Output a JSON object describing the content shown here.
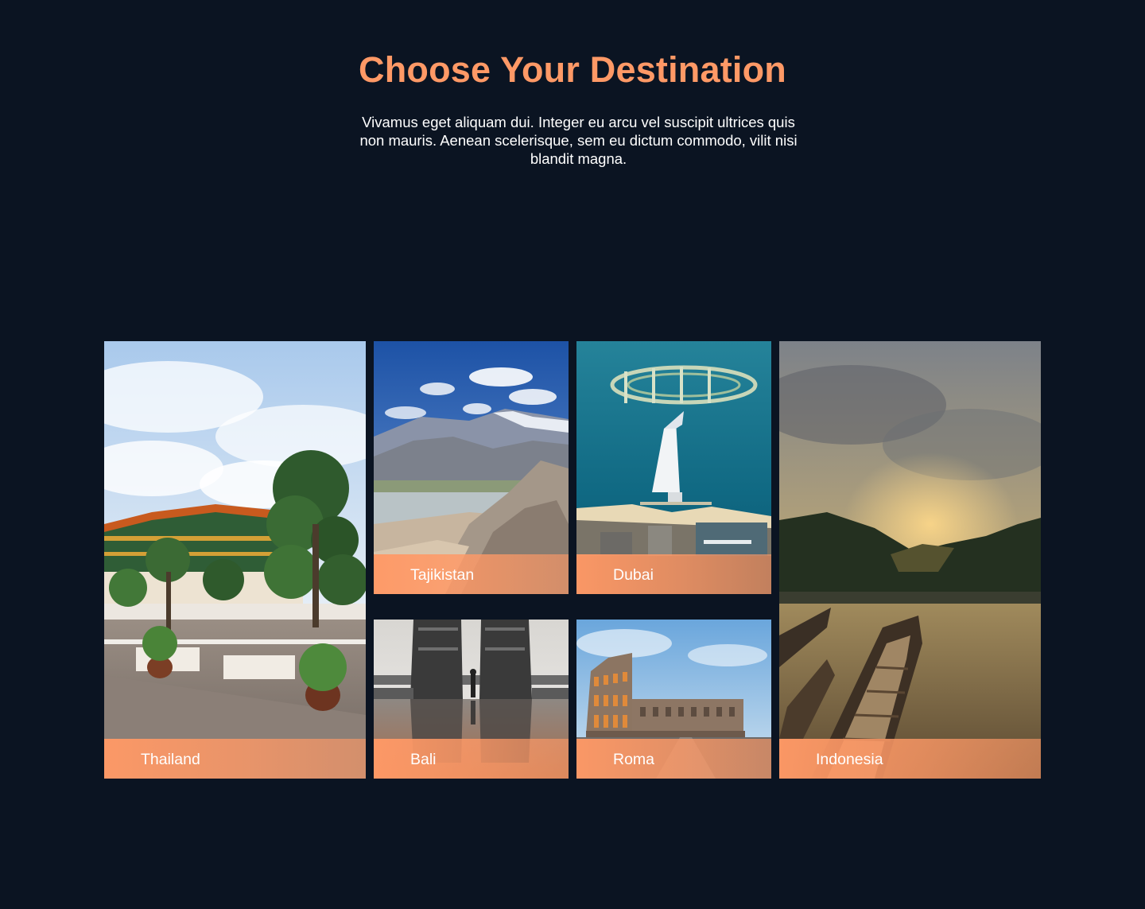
{
  "header": {
    "title": "Choose Your Destination",
    "description": "Vivamus eget aliquam dui. Integer eu arcu vel suscipit ultrices quis non mauris. Aenean scelerisque, sem eu dictum commodo, vilit nisi blandit magna."
  },
  "destinations": [
    {
      "name": "Thailand"
    },
    {
      "name": "Tajikistan"
    },
    {
      "name": "Dubai"
    },
    {
      "name": "Bali"
    },
    {
      "name": "Roma"
    },
    {
      "name": "Indonesia"
    }
  ],
  "colors": {
    "background": "#0b1422",
    "accent": "#ff9966",
    "text": "#ffffff"
  }
}
